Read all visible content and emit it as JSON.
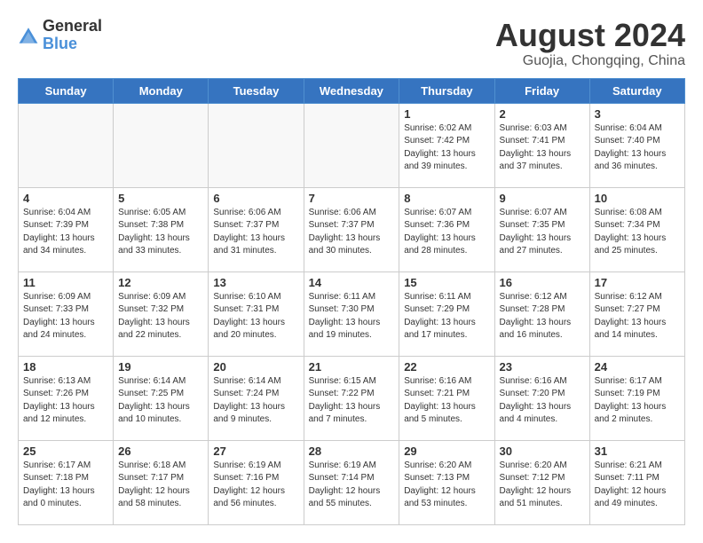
{
  "header": {
    "logo_general": "General",
    "logo_blue": "Blue",
    "month_title": "August 2024",
    "location": "Guojia, Chongqing, China"
  },
  "weekdays": [
    "Sunday",
    "Monday",
    "Tuesday",
    "Wednesday",
    "Thursday",
    "Friday",
    "Saturday"
  ],
  "weeks": [
    [
      {
        "day": "",
        "info": ""
      },
      {
        "day": "",
        "info": ""
      },
      {
        "day": "",
        "info": ""
      },
      {
        "day": "",
        "info": ""
      },
      {
        "day": "1",
        "info": "Sunrise: 6:02 AM\nSunset: 7:42 PM\nDaylight: 13 hours\nand 39 minutes."
      },
      {
        "day": "2",
        "info": "Sunrise: 6:03 AM\nSunset: 7:41 PM\nDaylight: 13 hours\nand 37 minutes."
      },
      {
        "day": "3",
        "info": "Sunrise: 6:04 AM\nSunset: 7:40 PM\nDaylight: 13 hours\nand 36 minutes."
      }
    ],
    [
      {
        "day": "4",
        "info": "Sunrise: 6:04 AM\nSunset: 7:39 PM\nDaylight: 13 hours\nand 34 minutes."
      },
      {
        "day": "5",
        "info": "Sunrise: 6:05 AM\nSunset: 7:38 PM\nDaylight: 13 hours\nand 33 minutes."
      },
      {
        "day": "6",
        "info": "Sunrise: 6:06 AM\nSunset: 7:37 PM\nDaylight: 13 hours\nand 31 minutes."
      },
      {
        "day": "7",
        "info": "Sunrise: 6:06 AM\nSunset: 7:37 PM\nDaylight: 13 hours\nand 30 minutes."
      },
      {
        "day": "8",
        "info": "Sunrise: 6:07 AM\nSunset: 7:36 PM\nDaylight: 13 hours\nand 28 minutes."
      },
      {
        "day": "9",
        "info": "Sunrise: 6:07 AM\nSunset: 7:35 PM\nDaylight: 13 hours\nand 27 minutes."
      },
      {
        "day": "10",
        "info": "Sunrise: 6:08 AM\nSunset: 7:34 PM\nDaylight: 13 hours\nand 25 minutes."
      }
    ],
    [
      {
        "day": "11",
        "info": "Sunrise: 6:09 AM\nSunset: 7:33 PM\nDaylight: 13 hours\nand 24 minutes."
      },
      {
        "day": "12",
        "info": "Sunrise: 6:09 AM\nSunset: 7:32 PM\nDaylight: 13 hours\nand 22 minutes."
      },
      {
        "day": "13",
        "info": "Sunrise: 6:10 AM\nSunset: 7:31 PM\nDaylight: 13 hours\nand 20 minutes."
      },
      {
        "day": "14",
        "info": "Sunrise: 6:11 AM\nSunset: 7:30 PM\nDaylight: 13 hours\nand 19 minutes."
      },
      {
        "day": "15",
        "info": "Sunrise: 6:11 AM\nSunset: 7:29 PM\nDaylight: 13 hours\nand 17 minutes."
      },
      {
        "day": "16",
        "info": "Sunrise: 6:12 AM\nSunset: 7:28 PM\nDaylight: 13 hours\nand 16 minutes."
      },
      {
        "day": "17",
        "info": "Sunrise: 6:12 AM\nSunset: 7:27 PM\nDaylight: 13 hours\nand 14 minutes."
      }
    ],
    [
      {
        "day": "18",
        "info": "Sunrise: 6:13 AM\nSunset: 7:26 PM\nDaylight: 13 hours\nand 12 minutes."
      },
      {
        "day": "19",
        "info": "Sunrise: 6:14 AM\nSunset: 7:25 PM\nDaylight: 13 hours\nand 10 minutes."
      },
      {
        "day": "20",
        "info": "Sunrise: 6:14 AM\nSunset: 7:24 PM\nDaylight: 13 hours\nand 9 minutes."
      },
      {
        "day": "21",
        "info": "Sunrise: 6:15 AM\nSunset: 7:22 PM\nDaylight: 13 hours\nand 7 minutes."
      },
      {
        "day": "22",
        "info": "Sunrise: 6:16 AM\nSunset: 7:21 PM\nDaylight: 13 hours\nand 5 minutes."
      },
      {
        "day": "23",
        "info": "Sunrise: 6:16 AM\nSunset: 7:20 PM\nDaylight: 13 hours\nand 4 minutes."
      },
      {
        "day": "24",
        "info": "Sunrise: 6:17 AM\nSunset: 7:19 PM\nDaylight: 13 hours\nand 2 minutes."
      }
    ],
    [
      {
        "day": "25",
        "info": "Sunrise: 6:17 AM\nSunset: 7:18 PM\nDaylight: 13 hours\nand 0 minutes."
      },
      {
        "day": "26",
        "info": "Sunrise: 6:18 AM\nSunset: 7:17 PM\nDaylight: 12 hours\nand 58 minutes."
      },
      {
        "day": "27",
        "info": "Sunrise: 6:19 AM\nSunset: 7:16 PM\nDaylight: 12 hours\nand 56 minutes."
      },
      {
        "day": "28",
        "info": "Sunrise: 6:19 AM\nSunset: 7:14 PM\nDaylight: 12 hours\nand 55 minutes."
      },
      {
        "day": "29",
        "info": "Sunrise: 6:20 AM\nSunset: 7:13 PM\nDaylight: 12 hours\nand 53 minutes."
      },
      {
        "day": "30",
        "info": "Sunrise: 6:20 AM\nSunset: 7:12 PM\nDaylight: 12 hours\nand 51 minutes."
      },
      {
        "day": "31",
        "info": "Sunrise: 6:21 AM\nSunset: 7:11 PM\nDaylight: 12 hours\nand 49 minutes."
      }
    ]
  ]
}
